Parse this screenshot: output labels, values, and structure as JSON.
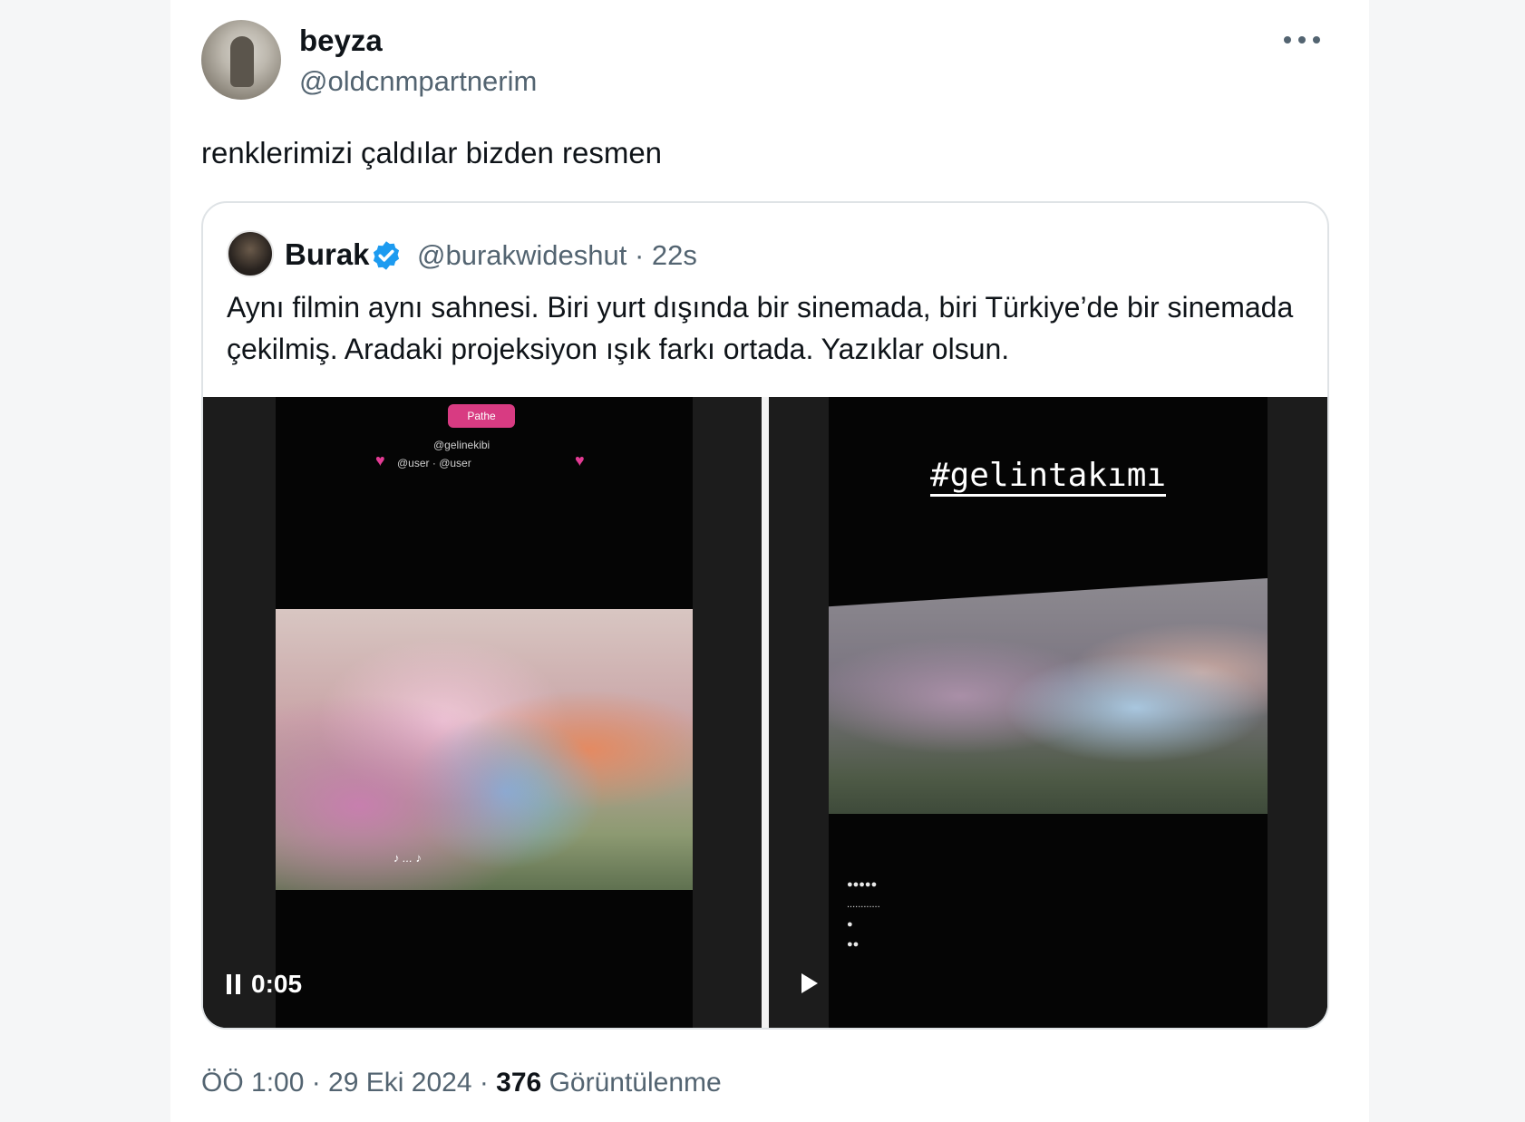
{
  "author": {
    "name": "beyza",
    "handle": "@oldcnmpartnerim"
  },
  "tweet": {
    "text": "renklerimizi çaldılar bizden resmen"
  },
  "quote": {
    "name": "Burak",
    "handle": "@burakwideshut · 22s",
    "text": "Aynı filmin aynı sahnesi. Biri yurt dışında bir sinemada, biri Türkiye’de bir sinemada çekilmiş. Aradaki projeksiyon ışık farkı ortada. Yazıklar olsun.",
    "verified_color": "#1d9bf0"
  },
  "media": {
    "left": {
      "badge": "Pathe",
      "time": "0:05"
    },
    "right": {
      "hashtag": "#gelintakımı"
    }
  },
  "footer": {
    "time_date": "ÖÖ 1:00 · 29 Eki 2024 · ",
    "views_count": "376",
    "views_label": " Görüntülenme"
  }
}
